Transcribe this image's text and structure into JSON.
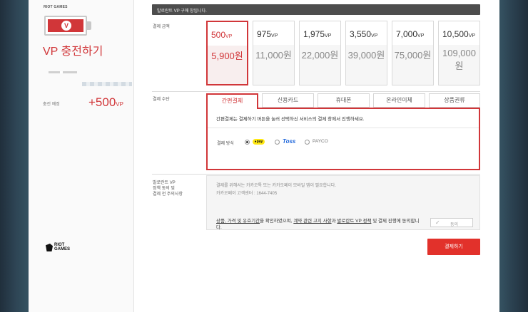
{
  "sidebar": {
    "brand": "RIOT GAMES",
    "title": "VP 충전하기",
    "charge_label": "충전 예정",
    "charge_amount": "+500",
    "charge_unit": "VP",
    "footer_logo": [
      "RIOT",
      "GAMES"
    ],
    "battery_icon": "valorant-icon"
  },
  "header": {
    "notice": "발로란트 VP 구매 창입니다."
  },
  "amount_section": {
    "label": "결제 금액",
    "unit": "VP",
    "options": [
      {
        "vp": "500",
        "price": "5,900원",
        "selected": true
      },
      {
        "vp": "975",
        "price": "11,000원",
        "selected": false
      },
      {
        "vp": "1,975",
        "price": "22,000원",
        "selected": false
      },
      {
        "vp": "3,550",
        "price": "39,000원",
        "selected": false
      },
      {
        "vp": "7,000",
        "price": "75,000원",
        "selected": false
      },
      {
        "vp": "10,500",
        "price": "109,000원",
        "selected": false
      }
    ]
  },
  "method_section": {
    "label": "결제 수단",
    "tabs": [
      "간편결제",
      "신용카드",
      "휴대폰",
      "온라인이체",
      "상품권류"
    ],
    "active_tab": 0,
    "description": "간편결제는 결제하기 버튼을 눌러 선택하신 서비스의 결제 창에서 진행하세요.",
    "method_label": "결제 방식",
    "methods": [
      "●pay",
      "Toss",
      "PAYCO"
    ],
    "selected_method": 0
  },
  "notice_section": {
    "label_lines": [
      "발로란트 VP",
      "정책 동의 및",
      "결제 전 주의사항"
    ],
    "line1": "결제를 위해서는 카카오톡 또는 카카오페이 모바일 앱이 필요합니다.",
    "line2": "카카오페이 고객센터 : 1644-7405",
    "agree_parts": [
      "상품, 가격 및 유효기간",
      "을 확인하였으며, ",
      "계약 관련 고지 사항",
      "과 ",
      "발로란트 VP 정책",
      " 및 결제 진행에 동의합니다."
    ],
    "agree_button": "동의"
  },
  "pay_button": "결제하기",
  "colors": {
    "accent": "#d13639",
    "button": "#e2312b"
  }
}
